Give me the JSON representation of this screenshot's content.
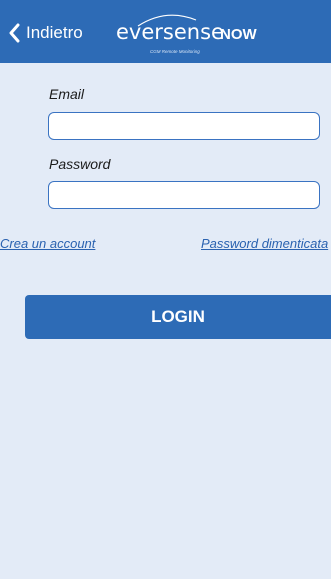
{
  "nav": {
    "back_label": "Indietro",
    "logo_word": "eversense",
    "logo_now": "NOW",
    "logo_tagline": "CGM Remote Monitoring"
  },
  "form": {
    "email_label": "Email",
    "email_value": "",
    "password_label": "Password",
    "password_value": ""
  },
  "links": {
    "create_account": "Crea un account",
    "forgot_password": "Password dimenticata"
  },
  "login_button": "LOGIN",
  "colors": {
    "brand_blue": "#2d6bb6",
    "background": "#e3ebf7",
    "link": "#2a62b0"
  },
  "icons": {
    "back": "chevron-left-icon"
  }
}
